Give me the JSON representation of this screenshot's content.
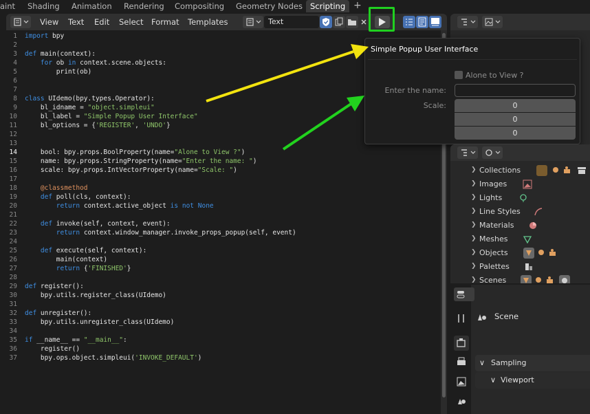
{
  "workspace_tabs": [
    {
      "label": "aint"
    },
    {
      "label": "Shading"
    },
    {
      "label": "Animation"
    },
    {
      "label": "Rendering"
    },
    {
      "label": "Compositing"
    },
    {
      "label": "Geometry Nodes"
    },
    {
      "label": "Scripting"
    }
  ],
  "editor_menu": [
    "View",
    "Text",
    "Edit",
    "Select",
    "Format",
    "Templates"
  ],
  "text_datablock": "Text",
  "code_lines": [
    "import bpy",
    "",
    "def main(context):",
    "    for ob in context.scene.objects:",
    "        print(ob)",
    "",
    "",
    "class UIdemo(bpy.types.Operator):",
    "    bl_idname = \"object.simpleui\"",
    "    bl_label = \"Simple Popup User Interface\"",
    "    bl_options = {'REGISTER', 'UNDO'}",
    "",
    "",
    "    bool: bpy.props.BoolProperty(name=\"Alone to View ?\")",
    "    name: bpy.props.StringProperty(name=\"Enter the name: \")",
    "    scale: bpy.props.IntVectorProperty(name=\"Scale: \")",
    "",
    "    @classmethod",
    "    def poll(cls, context):",
    "        return context.active_object is not None",
    "",
    "    def invoke(self, context, event):",
    "        return context.window_manager.invoke_props_popup(self, event)",
    "",
    "    def execute(self, context):",
    "        main(context)",
    "        return {'FINISHED'}",
    "",
    "def register():",
    "    bpy.utils.register_class(UIdemo)",
    "",
    "def unregister():",
    "    bpy.utils.unregister_class(UIdemo)",
    "",
    "if __name__ == \"__main__\":",
    "    register()",
    "    bpy.ops.object.simpleui('INVOKE_DEFAULT')"
  ],
  "current_line": 14,
  "popup": {
    "title": "Simple Popup User Interface",
    "checkbox_label": "Alone to View ?",
    "name_label": "Enter the name:",
    "name_value": "",
    "scale_label": "Scale:",
    "scale_values": [
      "0",
      "0",
      "0"
    ]
  },
  "outliner_items": [
    "Collections",
    "Images",
    "Lights",
    "Line Styles",
    "Materials",
    "Meshes",
    "Objects",
    "Palettes",
    "Scenes"
  ],
  "properties": {
    "scene_label": "Scene",
    "sampling_label": "Sampling",
    "viewport_label": "Viewport"
  },
  "colors": {
    "highlight_green": "#20d020",
    "arrow_yellow": "#f2e30f",
    "arrow_green": "#22d21e",
    "accent_blue": "#4772b3"
  }
}
